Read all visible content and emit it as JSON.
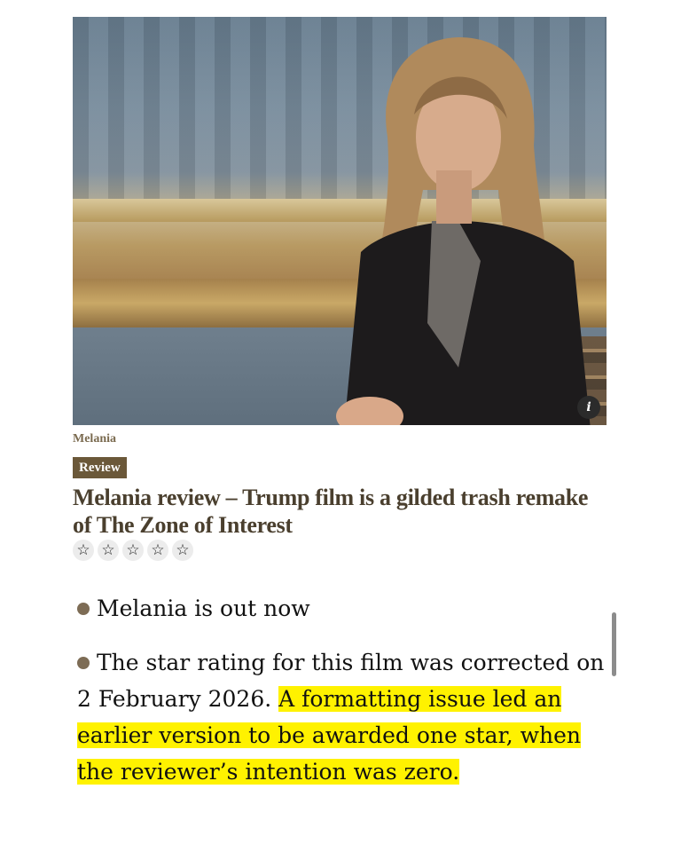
{
  "hero": {
    "info_label": "i"
  },
  "article": {
    "kicker": "Melania",
    "tag": "Review",
    "headline": "Melania review – Trump film is a gilded trash remake of The Zone of Interest",
    "rating": {
      "stars_filled": 0,
      "stars_total": 5,
      "star_glyph": "☆"
    }
  },
  "bullets": [
    {
      "text": "Melania is out now"
    },
    {
      "text_plain": "The star rating for this film was corrected on 2 February 2026. ",
      "text_highlight": "A formatting issue led an earlier version to be awarded one star, when the reviewer’s intention was zero."
    }
  ],
  "colors": {
    "highlight": "#fff200",
    "tag_bg": "#6b5839",
    "headline": "#4a3f2e",
    "kicker": "#7a6a4f"
  }
}
